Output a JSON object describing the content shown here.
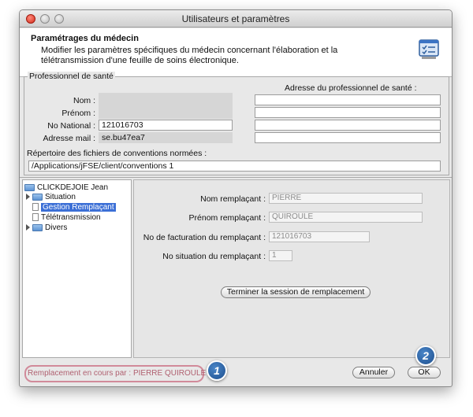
{
  "window": {
    "title": "Utilisateurs et paramètres"
  },
  "header": {
    "title": "Paramétrages du médecin",
    "description": "Modifier les paramètres spécifiques du médecin concernant l'élaboration et la télétransmission d'une feuille de soins électronique.",
    "icon": "settings-checklist-icon"
  },
  "professionnel": {
    "legend": "Professionnel de santé",
    "nom_label": "Nom :",
    "nom_value": "",
    "prenom_label": "Prénom :",
    "prenom_value": "",
    "no_national_label": "No National :",
    "no_national_value": "121016703",
    "adresse_mail_label": "Adresse mail :",
    "adresse_mail_value": "se.bu47ea7",
    "adresse_title": "Adresse du professionnel de santé :",
    "adresse_lines": [
      "",
      "",
      "",
      ""
    ],
    "repertoire_label": "Répertoire des fichiers de conventions normées :",
    "repertoire_value": "/Applications/jFSE/client/conventions 1"
  },
  "tree": {
    "root": "CLICKDEJOIE Jean",
    "items": [
      {
        "label": "Situation",
        "type": "folder"
      },
      {
        "label": "Gestion Remplaçant",
        "type": "doc",
        "selected": true
      },
      {
        "label": "Télétransmission",
        "type": "doc"
      },
      {
        "label": "Divers",
        "type": "folder"
      }
    ]
  },
  "remplacant": {
    "nom_label": "Nom remplaçant :",
    "nom_value": "PIERRE",
    "prenom_label": "Prénom remplaçant :",
    "prenom_value": "QUIROULE",
    "facturation_label": "No de facturation du remplaçant :",
    "facturation_value": "121016703",
    "situation_label": "No situation du remplaçant :",
    "situation_value": "1",
    "terminate_button": "Terminer la session de remplacement"
  },
  "footer": {
    "status": "Remplacement en cours par : PIERRE QUIROULE",
    "cancel_button": "Annuler",
    "ok_button": "OK"
  },
  "annotations": {
    "badge1": "1",
    "badge2": "2"
  },
  "colors": {
    "selection": "#3b6fd6",
    "badge": "#2a5fa0",
    "status_border": "#d18a9a"
  }
}
